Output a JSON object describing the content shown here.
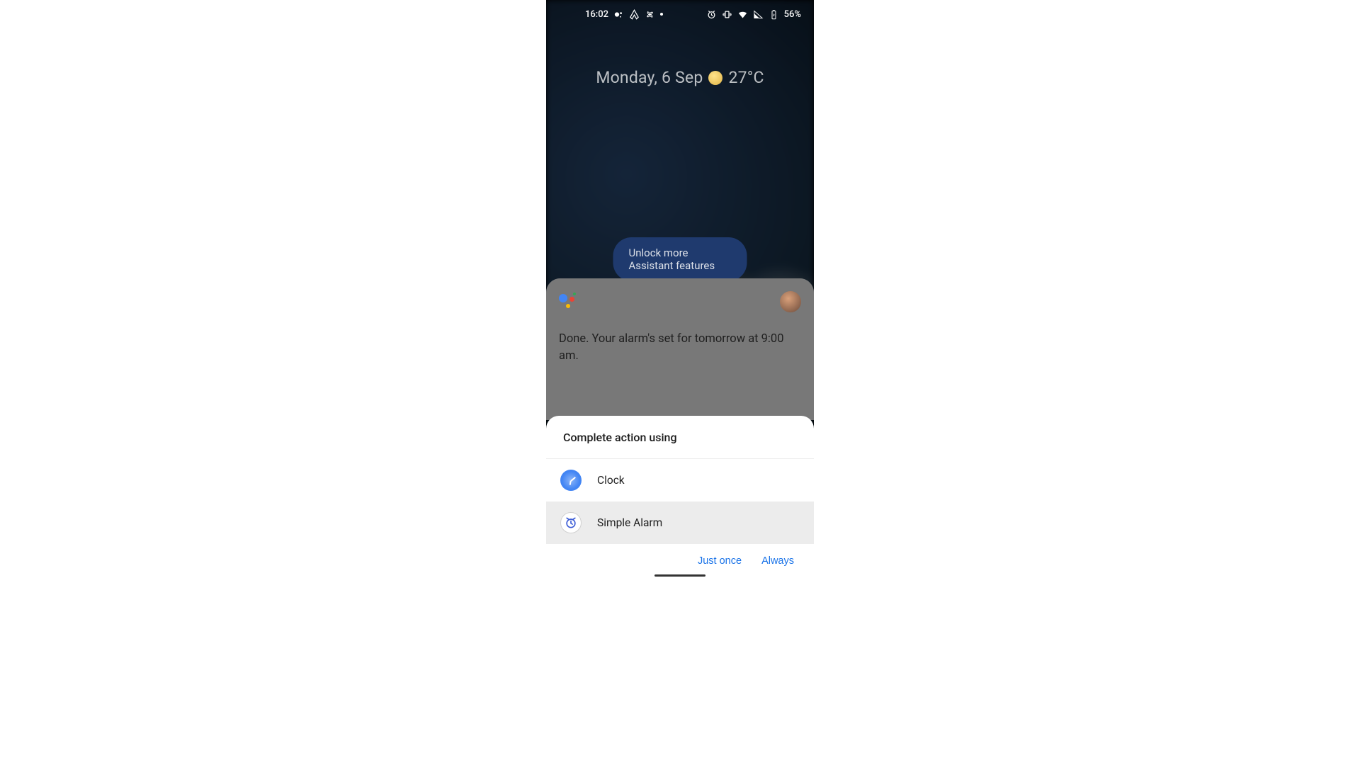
{
  "status": {
    "time": "16:02",
    "battery": "56%"
  },
  "home": {
    "date": "Monday, 6 Sep",
    "temperature": "27°C"
  },
  "assistant": {
    "unlock_label": "Unlock more Assistant features",
    "response": "Done. Your alarm's set for tomorrow at 9:00 am."
  },
  "sheet": {
    "title": "Complete action using",
    "options": [
      {
        "label": "Clock",
        "selected": false
      },
      {
        "label": "Simple Alarm",
        "selected": true
      }
    ],
    "actions": {
      "just_once": "Just once",
      "always": "Always"
    }
  }
}
